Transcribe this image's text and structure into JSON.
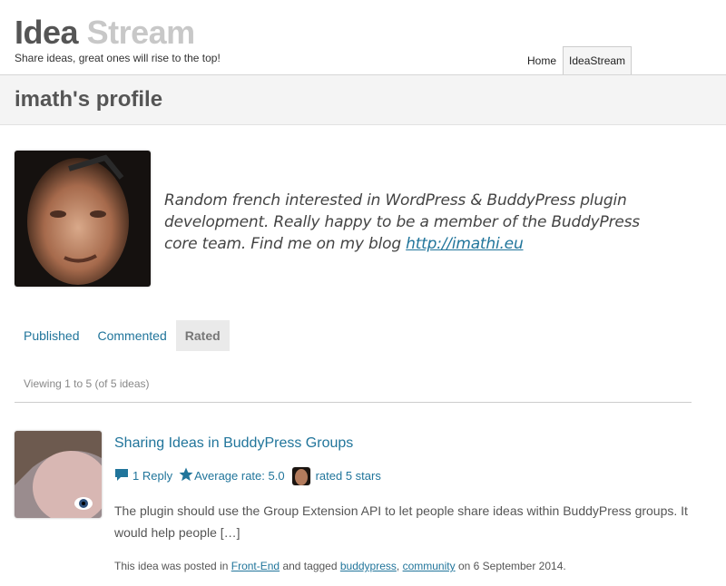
{
  "site": {
    "title_part1": "Idea",
    "title_part2": "Stream",
    "tagline": "Share ideas, great ones will rise to the top!"
  },
  "nav": {
    "items": [
      {
        "label": "Home"
      },
      {
        "label": "IdeaStream"
      }
    ],
    "active": "IdeaStream"
  },
  "profile": {
    "heading": "imath's profile",
    "bio_text": "Random french interested in WordPress & BuddyPress plugin development. Really happy to be a member of the BuddyPress core team. Find me on my blog",
    "bio_link": "http://imathi.eu"
  },
  "tabs": [
    {
      "label": "Published"
    },
    {
      "label": "Commented"
    },
    {
      "label": "Rated"
    }
  ],
  "active_tab": "Rated",
  "viewing_text": "Viewing 1 to 5 (of 5 ideas)",
  "idea": {
    "title": "Sharing Ideas in BuddyPress Groups",
    "replies": "1 Reply",
    "average": "Average rate: 5.0",
    "rated": "rated 5 stars",
    "excerpt": "The plugin should use the Group Extension API to let people share ideas within BuddyPress groups. It would help people […]",
    "posted_prefix": "This idea was posted in",
    "category": "Front-End",
    "tagged_text": "and tagged",
    "tag1": "buddypress",
    "tag_sep": ",",
    "tag2": "community",
    "date_text": "on 6 September 2014."
  },
  "colors": {
    "link": "#21759b",
    "brand_gray": "#555555",
    "brand_light": "#c8c8c8",
    "tab_active_bg": "#eaeaea"
  },
  "icons": {
    "reply": "speech-bubble-icon",
    "rating": "star-icon"
  }
}
